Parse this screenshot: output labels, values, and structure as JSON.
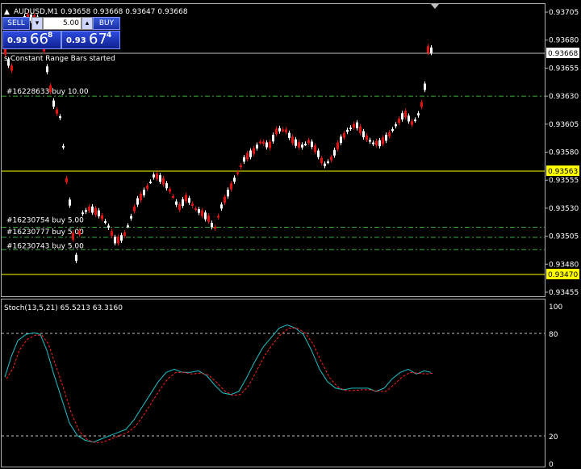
{
  "header": {
    "symbol_line": "AUDUSD,M1  0.93658 0.93668 0.93647 0.93668"
  },
  "trade_panel": {
    "sell_label": "SELL",
    "buy_label": "BUY",
    "lot_value": "5.00",
    "bid": {
      "prefix": "0.93",
      "big": "66",
      "sup": "8"
    },
    "ask": {
      "prefix": "0.93",
      "big": "67",
      "sup": "4"
    }
  },
  "chart_note": "s-Constant Range Bars started",
  "orders": [
    {
      "label": "#16228633 buy 10.00",
      "price": 0.9363
    },
    {
      "label": "#16230754 buy 5.00",
      "price": 0.93513
    },
    {
      "label": "#16230777 buy 5.00",
      "price": 0.93504
    },
    {
      "label": "#16230743 buy 5.00",
      "price": 0.93493
    }
  ],
  "price_axis": {
    "ticks": [
      "0.93705",
      "0.93680",
      "0.93655",
      "0.93630",
      "0.93605",
      "0.93580",
      "0.93555",
      "0.93530",
      "0.93505",
      "0.93480",
      "0.93455"
    ],
    "current_price": "0.93668",
    "level_high": "0.93563",
    "level_low": "0.93470"
  },
  "stoch": {
    "label": "Stoch(13,5,21) 65.5213 63.3160",
    "ticks": [
      "100",
      "80",
      "20",
      "0"
    ]
  },
  "colors": {
    "bull": "#ffffff",
    "bear": "#e81010",
    "level": "#ffff00",
    "order": "#3caa3c",
    "main": "#20c0c8",
    "signal": "#ff2020"
  }
}
